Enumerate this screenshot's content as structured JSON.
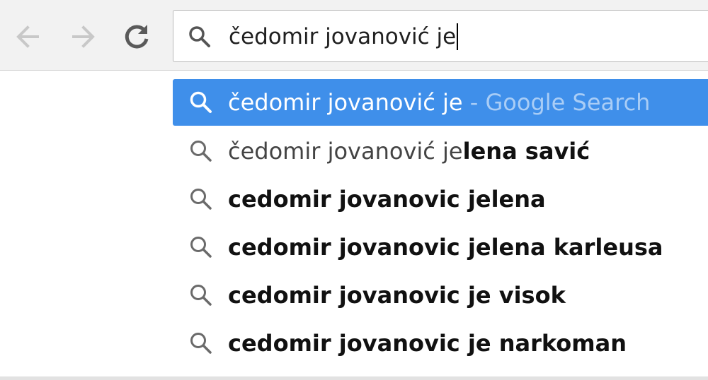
{
  "icons": {
    "back": "arrow-left-icon",
    "forward": "arrow-right-icon",
    "reload": "reload-icon",
    "search": "search-icon"
  },
  "colors": {
    "toolbar_bg": "#f2f2f2",
    "selected_bg": "#3f8fea",
    "disabled_arrow": "#c8c8c8",
    "reload_arrow": "#5a5a5a"
  },
  "omnibox": {
    "value": "čedomir jovanović je"
  },
  "suggestions": [
    {
      "typed": "čedomir jovanović je",
      "completion": "",
      "description": " - Google Search",
      "selected": true
    },
    {
      "typed": "čedomir jovanović je",
      "completion": "lena savić",
      "description": "",
      "selected": false
    },
    {
      "typed": "",
      "completion": "cedomir jovanovic jelena",
      "description": "",
      "selected": false
    },
    {
      "typed": "",
      "completion": "cedomir jovanovic jelena karleusa",
      "description": "",
      "selected": false
    },
    {
      "typed": "",
      "completion": "cedomir jovanovic je visok",
      "description": "",
      "selected": false
    },
    {
      "typed": "",
      "completion": "cedomir jovanovic je narkoman",
      "description": "",
      "selected": false
    }
  ]
}
